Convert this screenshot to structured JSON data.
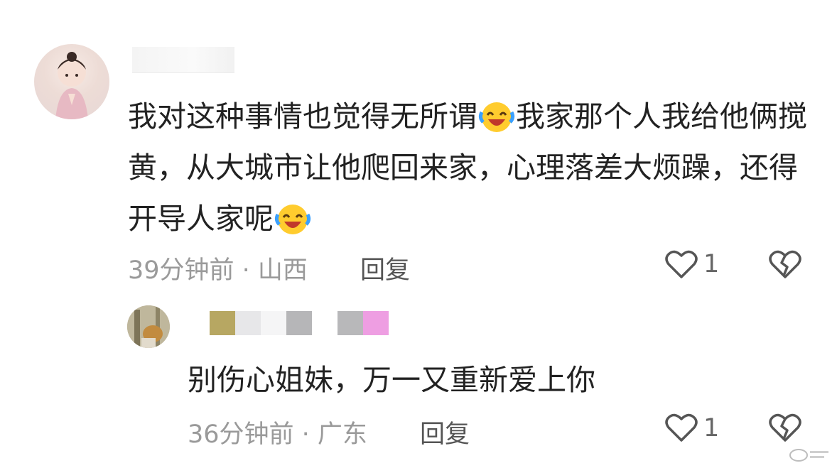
{
  "comment": {
    "username_hidden": true,
    "text_part1": "我对这种事情也觉得无所谓",
    "text_part2": "我家那个人我给他俩搅黄，从大城市让他爬回来家，心理落差大烦躁，还得开导人家呢",
    "emoji": "laughing-crying-emoji",
    "time_location": "39分钟前 · 山西",
    "reply_label": "回复",
    "like_count": "1"
  },
  "reply": {
    "username_mosaic_colors": [
      "#b7a762",
      "#e7e7e9",
      "#f5f5f6",
      "#b6b6b8",
      "#ffffff",
      "#b8b8ba",
      "#ee9ee2"
    ],
    "text": "别伤心姐妹，万一又重新爱上你",
    "time_location": "36分钟前 · 广东",
    "reply_label": "回复",
    "like_count": "1"
  },
  "colors": {
    "text": "#222222",
    "meta": "#9a9a9a",
    "icon_stroke": "#555555"
  }
}
